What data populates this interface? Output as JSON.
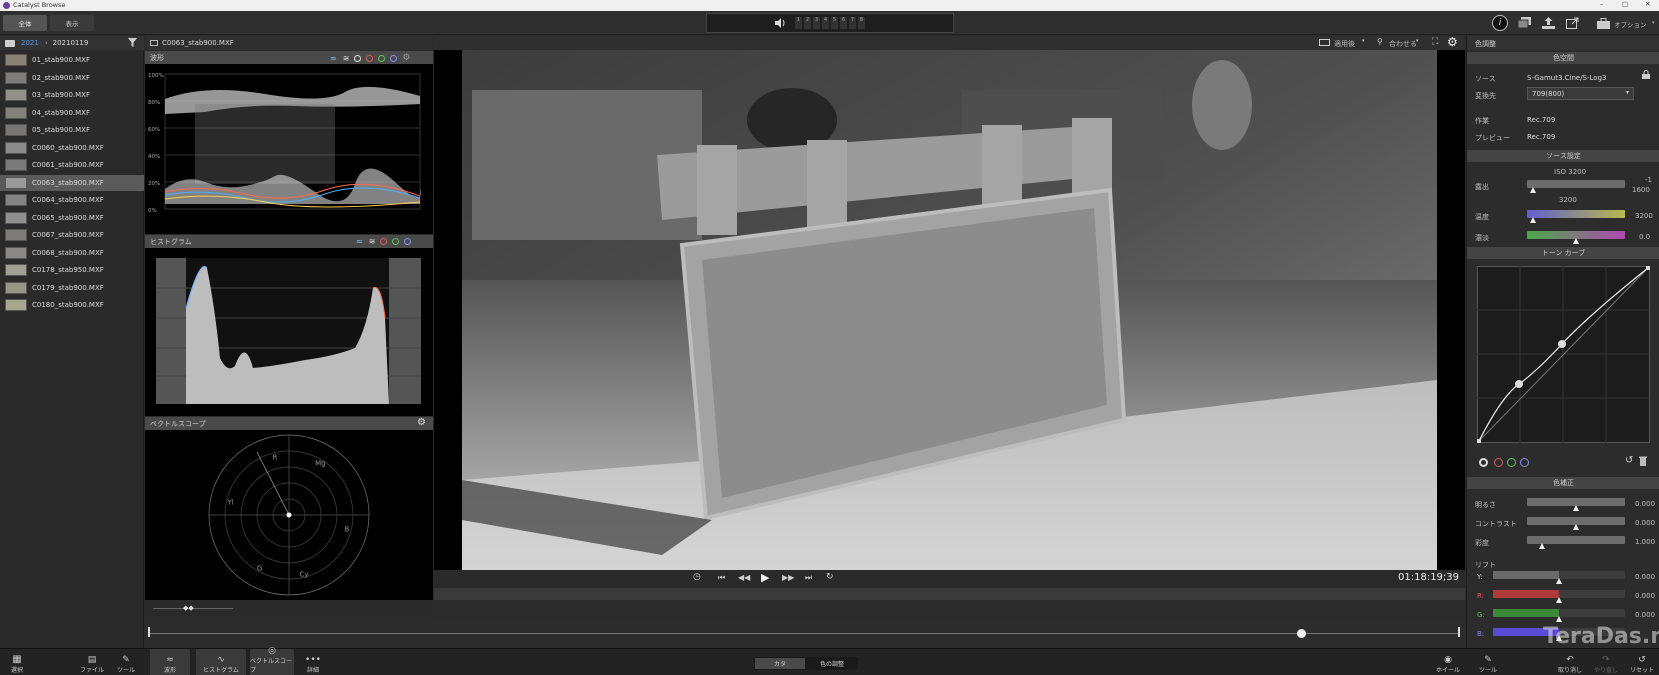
{
  "app": {
    "title": "Catalyst Browse"
  },
  "window_controls": {
    "minimize": "–",
    "maximize": "□",
    "close": "✕"
  },
  "top_tabs": [
    {
      "label": "全体"
    },
    {
      "label": "表示"
    }
  ],
  "audio_channels": [
    "1",
    "2",
    "3",
    "4",
    "5",
    "6",
    "7",
    "8"
  ],
  "right_toolbar": {
    "options_label": "オプション"
  },
  "breadcrumb": {
    "root": "2021",
    "folder": "20210119"
  },
  "files": [
    {
      "name": "01_stab900.MXF"
    },
    {
      "name": "02_stab900.MXF"
    },
    {
      "name": "03_stab900.MXF"
    },
    {
      "name": "04_stab900.MXF"
    },
    {
      "name": "05_stab900.MXF"
    },
    {
      "name": "C0060_stab900.MXF"
    },
    {
      "name": "C0061_stab900.MXF"
    },
    {
      "name": "C0063_stab900.MXF",
      "selected": true
    },
    {
      "name": "C0064_stab900.MXF"
    },
    {
      "name": "C0065_stab900.MXF"
    },
    {
      "name": "C0067_stab900.MXF"
    },
    {
      "name": "C0068_stab900.MXF"
    },
    {
      "name": "C0178_stab950.MXF"
    },
    {
      "name": "C0179_stab900.MXF"
    },
    {
      "name": "C0180_stab900.MXF"
    }
  ],
  "clip_title": "C0063_stab900.MXF",
  "waveform": {
    "title": "波形",
    "scale": [
      "100%",
      "80%",
      "60%",
      "40%",
      "20%",
      "0%"
    ]
  },
  "histogram": {
    "title": "ヒストグラム"
  },
  "vectorscope": {
    "title": "ベクトルスコープ",
    "labels": [
      "R",
      "Mg",
      "B",
      "Cy",
      "G",
      "Yl"
    ]
  },
  "viewer_toolbar": {
    "apply_label": "適用後",
    "fit_label": "合わせる"
  },
  "transport": {
    "timecode": "01:18:19;39",
    "playhead": 0.88
  },
  "color_panel": {
    "title": "色調整",
    "color_space": {
      "header": "色空間",
      "source_label": "ソース",
      "source_value": "S-Gamut3.Cine/S-Log3",
      "convert_label": "変換先",
      "convert_value": "709(800)",
      "work_label": "作業",
      "work_value": "Rec.709",
      "preview_label": "プレビュー",
      "preview_value": "Rec.709"
    },
    "source_settings": {
      "header": "ソース設定",
      "iso": "ISO 3200",
      "exposure_label": "露出",
      "exposure_values": [
        "-1",
        "1600"
      ],
      "iso_sub": "3200",
      "temp_label": "温度",
      "temp_value": "3200",
      "tint_label": "濃淡",
      "tint_value": "0.0"
    },
    "tone_curve": {
      "header": "トーン カーブ"
    },
    "color_correct": {
      "header": "色補正",
      "rows": [
        {
          "label": "明るさ",
          "value": "0.000"
        },
        {
          "label": "コントラスト",
          "value": "0.000"
        },
        {
          "label": "彩度",
          "value": "1.000"
        }
      ],
      "lift_label": "リフト",
      "lift_rows": [
        {
          "label": "Y:",
          "value": "0.000"
        },
        {
          "label": "R:",
          "value": "0.000"
        },
        {
          "label": "G:",
          "value": "0.000"
        },
        {
          "label": "B:",
          "value": ""
        }
      ]
    }
  },
  "bottom_left": [
    {
      "label": "選択"
    },
    {
      "label": "ファイル"
    },
    {
      "label": "ツール"
    }
  ],
  "bottom_scopes": [
    {
      "label": "波形"
    },
    {
      "label": "ヒストグラム"
    },
    {
      "label": "ベクトルスコープ"
    },
    {
      "label": "詳細"
    }
  ],
  "bottom_center": [
    {
      "label": "カタ"
    },
    {
      "label": "色の調整"
    }
  ],
  "bottom_right": [
    {
      "label": "ホイール"
    },
    {
      "label": "ツール"
    },
    {
      "label": "取り消し"
    },
    {
      "label": "やり直し"
    },
    {
      "label": "リセット"
    }
  ],
  "watermark": "TeraDas.net",
  "colors": {
    "accent": "#3d7bd9",
    "selected_row": "#5a5a5a",
    "panel": "#2b2b2b"
  }
}
